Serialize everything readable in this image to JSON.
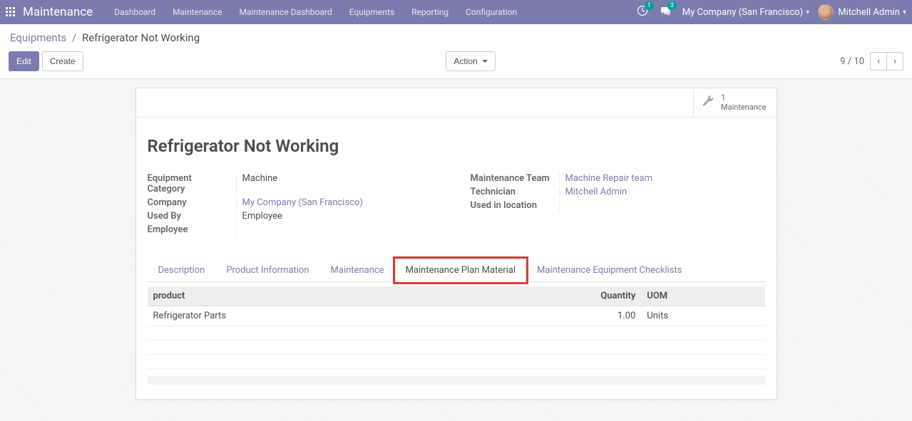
{
  "topnav": {
    "brand": "Maintenance",
    "menu": [
      "Dashboard",
      "Maintenance",
      "Maintenance Dashboard",
      "Equipments",
      "Reporting",
      "Configuration"
    ],
    "activity_count": "1",
    "discuss_count": "3",
    "company": "My Company (San Francisco)",
    "user": "Mitchell Admin"
  },
  "breadcrumb": {
    "root": "Equipments",
    "current": "Refrigerator Not Working"
  },
  "buttons": {
    "edit": "Edit",
    "create": "Create",
    "action": "Action"
  },
  "pager": {
    "pos": "9 / 10"
  },
  "stat": {
    "count": "1",
    "label": "Maintenance"
  },
  "record": {
    "title": "Refrigerator Not Working",
    "left": {
      "equipment_category": {
        "label": "Equipment Category",
        "value": "Machine"
      },
      "company": {
        "label": "Company",
        "value": "My Company (San Francisco)"
      },
      "used_by": {
        "label": "Used By",
        "value": "Employee"
      },
      "employee": {
        "label": "Employee",
        "value": ""
      }
    },
    "right": {
      "maintenance_team": {
        "label": "Maintenance Team",
        "value": "Machine Repair team"
      },
      "technician": {
        "label": "Technician",
        "value": "Mitchell Admin"
      },
      "used_in_location": {
        "label": "Used in location",
        "value": ""
      }
    }
  },
  "tabs": {
    "description": "Description",
    "product_info": "Product Information",
    "maintenance": "Maintenance",
    "plan_material": "Maintenance Plan Material",
    "checklists": "Maintenance Equipment Checklists"
  },
  "table": {
    "headers": {
      "product": "product",
      "quantity": "Quantity",
      "uom": "UOM"
    },
    "rows": [
      {
        "product": "Refrigerator Parts",
        "quantity": "1.00",
        "uom": "Units"
      }
    ]
  }
}
